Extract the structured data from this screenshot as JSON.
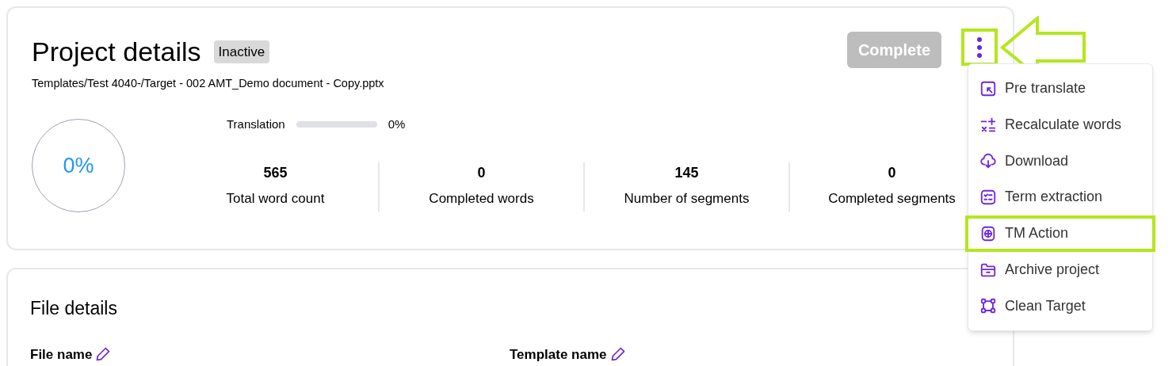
{
  "project": {
    "title": "Project details",
    "status": "Inactive",
    "path": "Templates/Test 4040-/Target - 002 AMT_Demo document - Copy.pptx",
    "overall": "0%",
    "complete_button": {
      "label": "Complete",
      "disabled": true
    },
    "progress": [
      {
        "label": "Translation",
        "level": 0,
        "reading": "0%"
      }
    ],
    "stats": [
      {
        "value": "565",
        "label": "Total word count"
      },
      {
        "value": "0",
        "label": "Completed words"
      },
      {
        "value": "145",
        "label": "Number of segments"
      },
      {
        "value": "0",
        "label": "Completed segments"
      }
    ]
  },
  "menu": {
    "button_highlighted": true,
    "items": [
      {
        "kind": "pretranslate",
        "label": "Pre translate",
        "highlighted": false
      },
      {
        "kind": "recalculate",
        "label": "Recalculate words",
        "highlighted": false
      },
      {
        "kind": "download",
        "label": "Download",
        "highlighted": false
      },
      {
        "kind": "terms",
        "label": "Term extraction",
        "highlighted": false
      },
      {
        "kind": "tm",
        "label": "TM Action",
        "highlighted": true
      },
      {
        "kind": "archive",
        "label": "Archive project",
        "highlighted": false
      },
      {
        "kind": "clean",
        "label": "Clean Target",
        "highlighted": false
      }
    ]
  },
  "file_details": {
    "title": "File details",
    "fields": [
      {
        "label": "File name"
      },
      {
        "label": "Template name"
      }
    ]
  }
}
